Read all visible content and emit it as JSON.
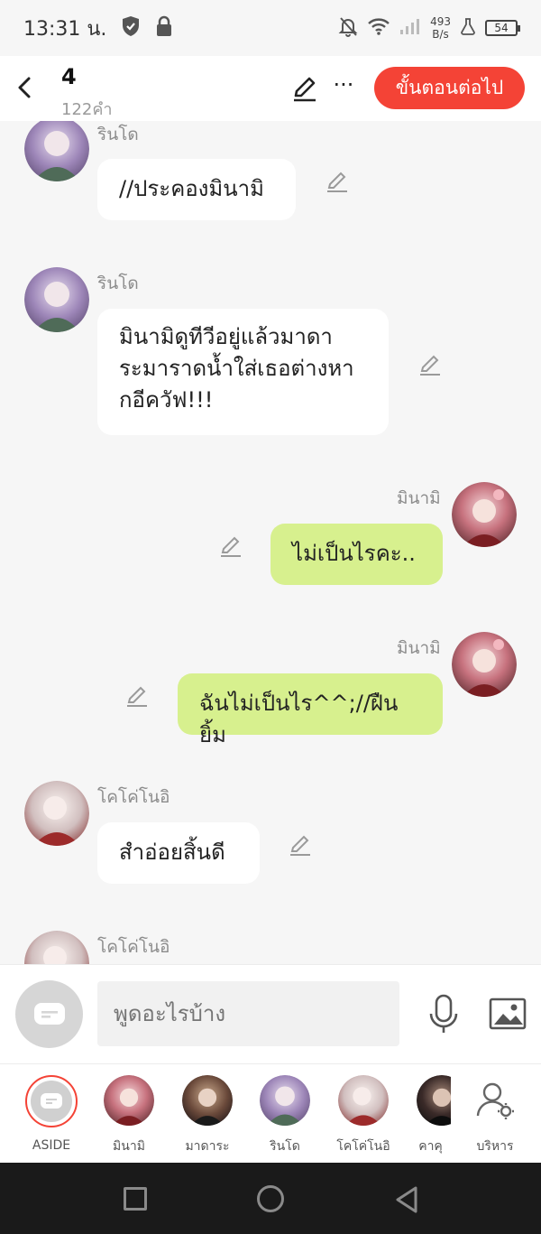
{
  "status_bar": {
    "time": "13:31 น.",
    "net_speed_value": "493",
    "net_speed_unit": "B/s",
    "battery": "54"
  },
  "header": {
    "chapter": "4",
    "word_count": "122คำ",
    "next_label": "ขั้นตอนต่อไป",
    "more_label": "···"
  },
  "messages": [
    {
      "sender": "รินโด",
      "text": "//ประคองมินามิ",
      "side": "left",
      "avatar": "purple"
    },
    {
      "sender": "รินโด",
      "text": "มินามิดูทีวีอยู่แล้วมาดาระมาราดน้ำใส่เธอต่างหากอีควัฟ!!!",
      "lines": [
        "มินามิดูทีวีอยู่แล้วมาดา",
        "ระมาราดน้ำใส่เธอต่างหา",
        "กอีควัฟ!!!"
      ],
      "side": "left",
      "avatar": "purple"
    },
    {
      "sender": "มินามิ",
      "text": "ไม่เป็นไรคะ..",
      "side": "right",
      "avatar": "pink"
    },
    {
      "sender": "มินามิ",
      "text": "ฉันไม่เป็นไร^^;//ฝืนยิ้ม",
      "side": "right",
      "avatar": "pink"
    },
    {
      "sender": "โคโค่โนอิ",
      "text": "สำอ่อยสิ้นดี",
      "side": "left",
      "avatar": "silver"
    },
    {
      "sender": "โคโค่โนอิ",
      "text": "",
      "side": "left",
      "avatar": "silver"
    }
  ],
  "input": {
    "placeholder": "พูดอะไรบ้าง"
  },
  "characters": [
    {
      "name": "ASIDE",
      "avatar": "aside"
    },
    {
      "name": "มินามิ",
      "avatar": "pink"
    },
    {
      "name": "มาดาระ",
      "avatar": "dark"
    },
    {
      "name": "รินโด",
      "avatar": "purple"
    },
    {
      "name": "โคโค่โนอิ",
      "avatar": "silver"
    },
    {
      "name": "คาคุ",
      "avatar": "black"
    },
    {
      "name": "บริหาร",
      "avatar": "manage"
    }
  ],
  "colors": {
    "accent": "#f44336",
    "bubble_left": "#ffffff",
    "bubble_right": "#d7f08e",
    "background": "#f6f6f6"
  }
}
